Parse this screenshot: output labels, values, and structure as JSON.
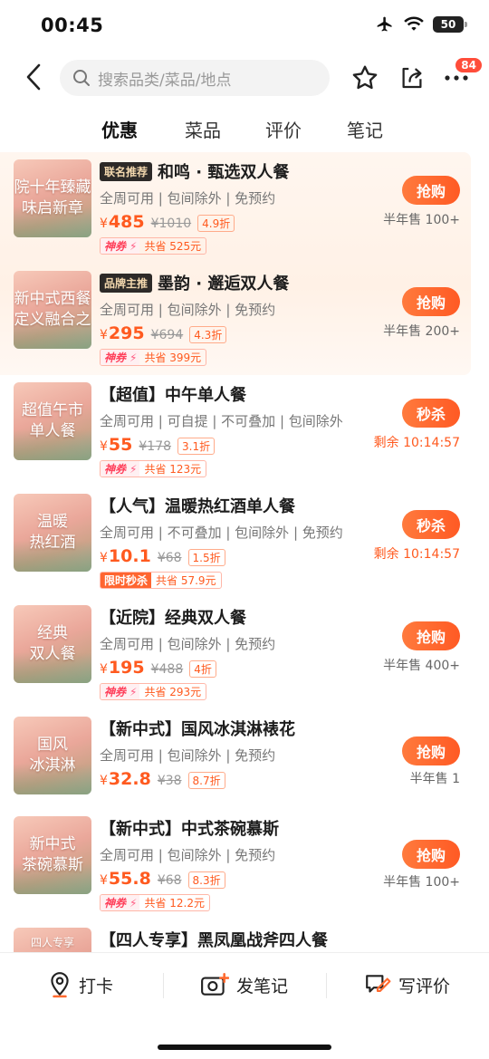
{
  "status_bar": {
    "time": "00:45",
    "battery": "50"
  },
  "navbar": {
    "search_placeholder": "搜索品类/菜品/地点",
    "message_badge": "84"
  },
  "tabs": [
    {
      "label": "优惠",
      "active": true
    },
    {
      "label": "菜品",
      "active": false
    },
    {
      "label": "评价",
      "active": false
    },
    {
      "label": "笔记",
      "active": false
    }
  ],
  "deals": [
    {
      "thumb_text": "院十年臻藏\n味启新章",
      "badge": "联名推荐",
      "title": "和鸣 · 甄选双人餐",
      "tags": "全周可用 | 包间除外 | 免预约",
      "price": "485",
      "original": "¥1010",
      "discount": "4.9折",
      "saving_label": "神券",
      "saving": "共省 525元",
      "button": "抢购",
      "sold": "半年售 100+"
    },
    {
      "thumb_text": "新中式西餐\n定义融合之",
      "badge": "品牌主推",
      "title": "墨韵 · 邂逅双人餐",
      "tags": "全周可用 | 包间除外 | 免预约",
      "price": "295",
      "original": "¥694",
      "discount": "4.3折",
      "saving_label": "神券",
      "saving": "共省 399元",
      "button": "抢购",
      "sold": "半年售 200+"
    },
    {
      "thumb_text": "超值午市\n单人餐",
      "badge": "",
      "title": "【超值】中午单人餐",
      "tags": "全周可用 | 可自提 | 不可叠加 | 包间除外",
      "price": "55",
      "original": "¥178",
      "discount": "3.1折",
      "saving_label": "神券",
      "saving": "共省 123元",
      "button": "秒杀",
      "sold": "剩余 10:14:57"
    },
    {
      "thumb_text": "温暖\n热红酒",
      "badge": "",
      "title": "【人气】温暖热红酒单人餐",
      "tags": "全周可用 | 不可叠加 | 包间除外 | 免预约",
      "price": "10.1",
      "original": "¥68",
      "discount": "1.5折",
      "saving_label": "限时秒杀",
      "saving": "共省 57.9元",
      "button": "秒杀",
      "sold": "剩余 10:14:57"
    },
    {
      "thumb_text": "经典\n双人餐",
      "badge": "",
      "title": "【近院】经典双人餐",
      "tags": "全周可用 | 包间除外 | 免预约",
      "price": "195",
      "original": "¥488",
      "discount": "4折",
      "saving_label": "神券",
      "saving": "共省 293元",
      "button": "抢购",
      "sold": "半年售 400+"
    },
    {
      "thumb_text": "国风\n冰淇淋",
      "badge": "",
      "title": "【新中式】国风冰淇淋裱花",
      "tags": "全周可用 | 包间除外 | 免预约",
      "price": "32.8",
      "original": "¥38",
      "discount": "8.7折",
      "saving_label": "",
      "saving": "",
      "button": "抢购",
      "sold": "半年售 1"
    },
    {
      "thumb_text": "新中式\n茶碗慕斯",
      "badge": "",
      "title": "【新中式】中式茶碗慕斯",
      "tags": "全周可用 | 包间除外 | 免预约",
      "price": "55.8",
      "original": "¥68",
      "discount": "8.3折",
      "saving_label": "神券",
      "saving": "共省 12.2元",
      "button": "抢购",
      "sold": "半年售 100+"
    },
    {
      "thumb_text": "四人专享",
      "badge": "",
      "title": "【四人专享】黑凤凰战斧四人餐",
      "tags": "",
      "price": "",
      "original": "",
      "discount": "",
      "saving_label": "",
      "saving": "",
      "button": "",
      "sold": ""
    }
  ],
  "bottom_bar": [
    {
      "label": "打卡",
      "icon": "location-pin-icon"
    },
    {
      "label": "发笔记",
      "icon": "camera-add-icon"
    },
    {
      "label": "写评价",
      "icon": "write-review-icon"
    }
  ],
  "colors": {
    "accent": "#ff5a1f",
    "button": "#ff6a2f",
    "badge": "#ff4d3a"
  }
}
